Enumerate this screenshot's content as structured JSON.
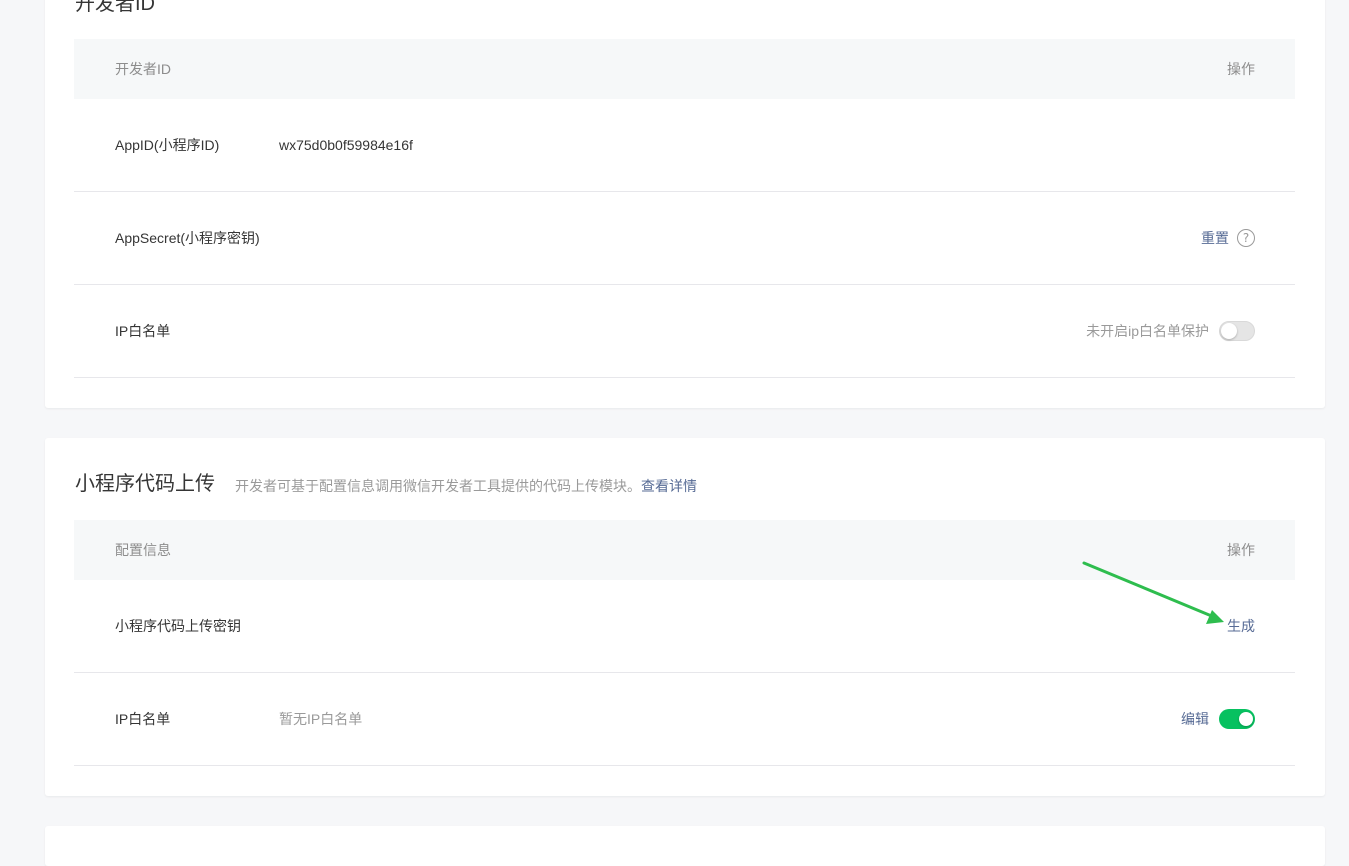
{
  "developer_id_section": {
    "title": "开发者ID",
    "table_header": {
      "left": "开发者ID",
      "right": "操作"
    },
    "rows": [
      {
        "label": "AppID(小程序ID)",
        "value": "wx75d0b0f59984e16f"
      },
      {
        "label": "AppSecret(小程序密钥)",
        "action": "重置",
        "help_icon": "?"
      },
      {
        "label": "IP白名单",
        "status_text": "未开启ip白名单保护",
        "toggle_on": false
      }
    ]
  },
  "code_upload_section": {
    "title": "小程序代码上传",
    "description": "开发者可基于配置信息调用微信开发者工具提供的代码上传模块。",
    "details_link": "查看详情",
    "table_header": {
      "left": "配置信息",
      "right": "操作"
    },
    "rows": [
      {
        "label": "小程序代码上传密钥",
        "action": "生成"
      },
      {
        "label": "IP白名单",
        "value": "暂无IP白名单",
        "action": "编辑",
        "toggle_on": true
      }
    ]
  },
  "colors": {
    "page_bg": "#f6f7f9",
    "link": "#576b95",
    "toggle_on": "#07c160",
    "annotation_arrow": "#2ebd4e"
  }
}
